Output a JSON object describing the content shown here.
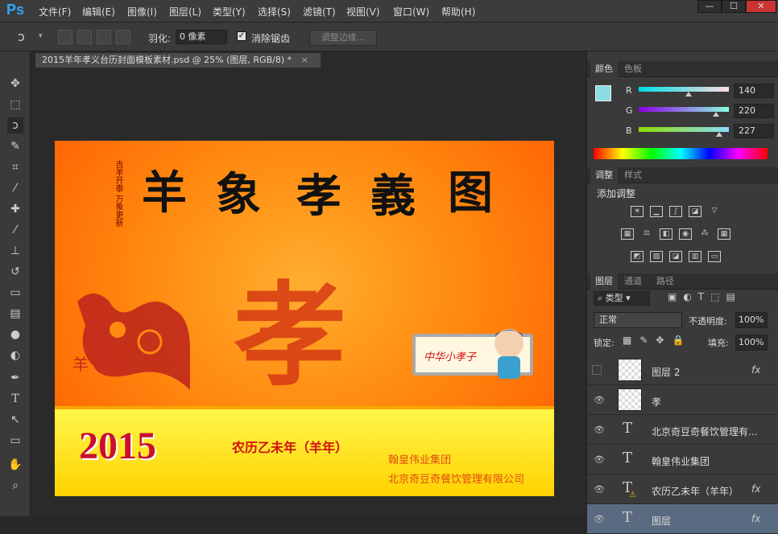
{
  "app": {
    "logo": "Ps",
    "menus": [
      "文件(F)",
      "编辑(E)",
      "图像(I)",
      "图层(L)",
      "类型(Y)",
      "选择(S)",
      "滤镜(T)",
      "视图(V)",
      "窗口(W)",
      "帮助(H)"
    ],
    "window_buttons": [
      "—",
      "☐",
      "✕"
    ]
  },
  "options": {
    "feather_label": "羽化:",
    "feather_value": "0 像素",
    "antialias_label": "消除锯齿",
    "refine_label": "调整边缘..."
  },
  "document": {
    "tab_title": "2015羊年孝义台历封面模板素材.psd @ 25% (图层, RGB/8) *",
    "close": "×"
  },
  "artwork": {
    "title_chars": [
      "羊",
      "象",
      "孝",
      "義",
      "图"
    ],
    "vertical_text": "吉羊开泰 万象更新",
    "big_char": "孝",
    "side_char": "羊",
    "scroll_text": "中华小孝子",
    "year": "2015",
    "lunar": "农历乙未年（羊年）",
    "company1": "翰皇伟业集团",
    "company2": "北京奇豆奇餐饮管理有限公司"
  },
  "color_panel": {
    "tabs": [
      "颜色",
      "色板"
    ],
    "channels": [
      {
        "label": "R",
        "value": "140",
        "level": 0.55
      },
      {
        "label": "G",
        "value": "220",
        "level": 0.86
      },
      {
        "label": "B",
        "value": "227",
        "level": 0.89
      }
    ],
    "fg_color": "#8cdce3"
  },
  "adjust_panel": {
    "tabs": [
      "调整",
      "样式"
    ],
    "title": "添加调整"
  },
  "layers_panel": {
    "tabs": [
      "图层",
      "通道",
      "路径"
    ],
    "kind_label": "类型",
    "blend_mode": "正常",
    "opacity_label": "不透明度:",
    "opacity_value": "100%",
    "lock_label": "锁定:",
    "fill_label": "填充:",
    "fill_value": "100%",
    "layers": [
      {
        "name": "图层 2",
        "type": "image",
        "visible": false,
        "fx": "fx"
      },
      {
        "name": "孝",
        "type": "image",
        "visible": true,
        "fx": ""
      },
      {
        "name": "北京奇豆奇餐饮管理有...",
        "type": "text",
        "visible": true,
        "fx": ""
      },
      {
        "name": "翰皇伟业集团",
        "type": "text",
        "visible": true,
        "fx": ""
      },
      {
        "name": "农历乙未年（羊年）",
        "type": "text",
        "visible": true,
        "fx": "fx"
      },
      {
        "name": "图层",
        "type": "text",
        "visible": true,
        "fx": "fx"
      }
    ]
  }
}
